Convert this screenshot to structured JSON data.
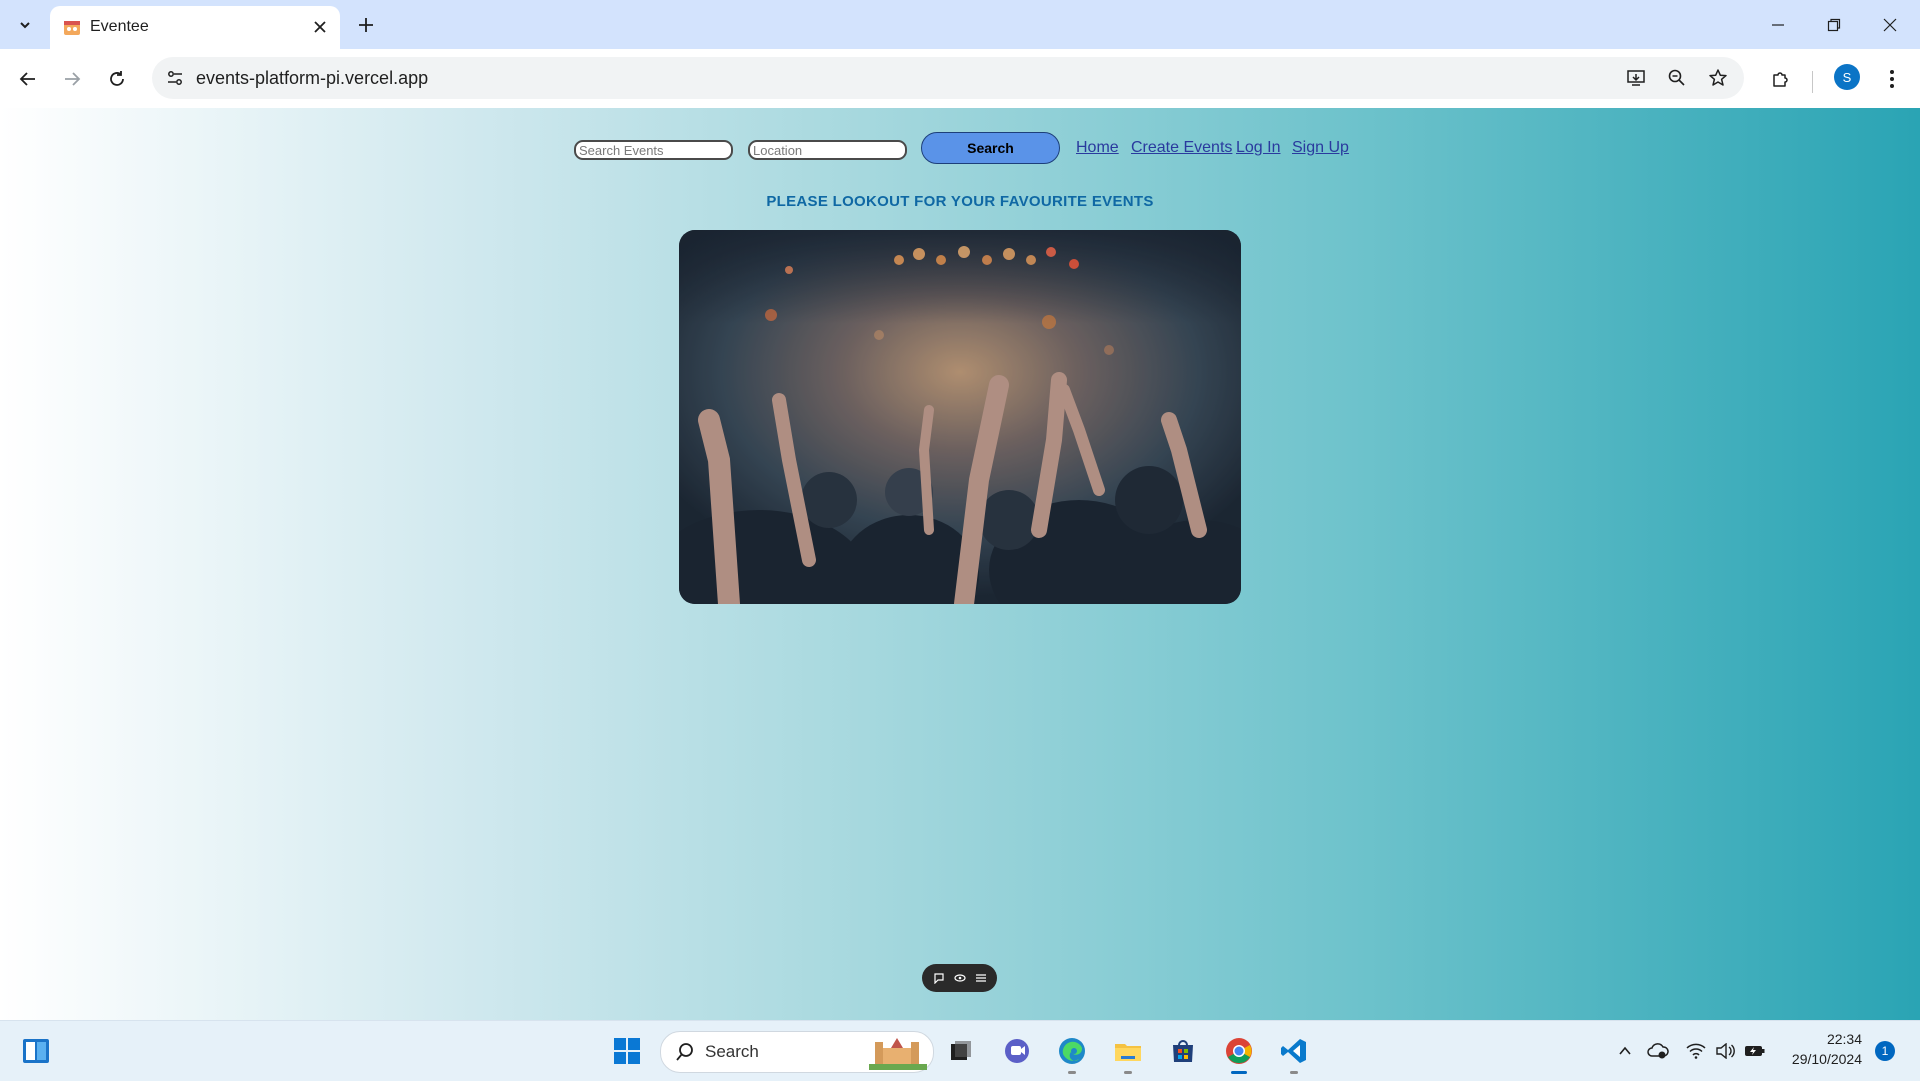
{
  "browser": {
    "tab_title": "Eventee",
    "url": "events-platform-pi.vercel.app",
    "profile_initial": "S"
  },
  "page": {
    "search_placeholder": "Search Events",
    "location_placeholder": "Location",
    "search_button": "Search",
    "nav_links": [
      "Home",
      "Create Events",
      "Log In",
      "Sign Up"
    ],
    "headline": "PLEASE LOOKOUT FOR YOUR FAVOURITE EVENTS",
    "hero_alt": "concert crowd with raised hands"
  },
  "taskbar": {
    "search_label": "Search",
    "time": "22:34",
    "date": "29/10/2024",
    "notification_count": "1",
    "apps": [
      "start-icon",
      "task-view-icon",
      "teams-icon",
      "edge-icon",
      "file-explorer-icon",
      "store-icon",
      "chrome-icon",
      "vscode-icon"
    ]
  },
  "colors": {
    "headline": "#0f68a4",
    "button": "#5a93e8",
    "link": "#2a3a9e",
    "gradient_end": "#2aa4b4"
  }
}
